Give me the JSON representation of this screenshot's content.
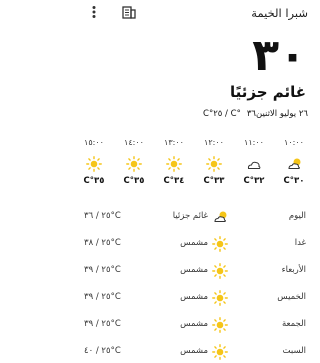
{
  "header": {
    "city": "شبرا الخيمة"
  },
  "current": {
    "temperature": "٣٠",
    "condition": "غائم جزئيًا"
  },
  "date": {
    "label": "٢٦ يوليو الاثنين",
    "range": "٣٦°C / ٢٥°C"
  },
  "hourly": [
    {
      "time": "١٠:٠٠",
      "icon": "partly-cloudy-icon",
      "temp": "٣٠°C"
    },
    {
      "time": "١١:٠٠",
      "icon": "cloud-icon",
      "temp": "٣٢°C"
    },
    {
      "time": "١٢:٠٠",
      "icon": "sun-icon",
      "temp": "٣٣°C"
    },
    {
      "time": "١٣:٠٠",
      "icon": "sun-icon",
      "temp": "٣٤°C"
    },
    {
      "time": "١٤:٠٠",
      "icon": "sun-icon",
      "temp": "٣٥°C"
    },
    {
      "time": "١٥:٠٠",
      "icon": "sun-icon",
      "temp": "٣٥°C"
    }
  ],
  "daily": [
    {
      "day": "اليوم",
      "icon": "partly-cloudy-icon",
      "condition": "غائم جزئيا",
      "range": "٢٥ / ٣٦°C"
    },
    {
      "day": "غدا",
      "icon": "sun-icon",
      "condition": "مشمس",
      "range": "٢٥ / ٣٨°C"
    },
    {
      "day": "الأربعاء",
      "icon": "sun-icon",
      "condition": "مشمس",
      "range": "٢٥ / ٣٩°C"
    },
    {
      "day": "الخميس",
      "icon": "sun-icon",
      "condition": "مشمس",
      "range": "٢٥ / ٣٩°C"
    },
    {
      "day": "الجمعة",
      "icon": "sun-icon",
      "condition": "مشمس",
      "range": "٢٥ / ٣٩°C"
    },
    {
      "day": "السبت",
      "icon": "sun-icon",
      "condition": "مشمس",
      "range": "٢٥ / ٤٠°C"
    }
  ],
  "colors": {
    "sun": "#f5c518",
    "cloud_stroke": "#333333"
  }
}
